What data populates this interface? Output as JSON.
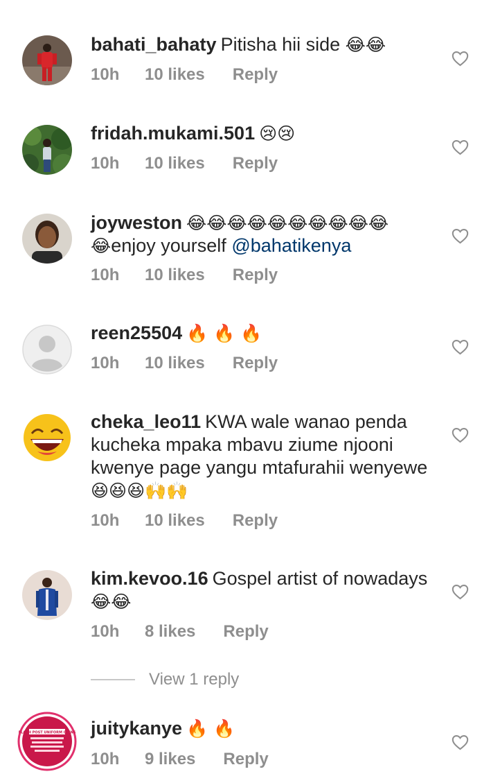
{
  "colors": {
    "meta": "#8e8e8e",
    "text": "#262626",
    "mention": "#00376b"
  },
  "comments": [
    {
      "username": "bahati_bahaty",
      "text": "Pitisha hii side",
      "emoji": "😂😂",
      "time": "10h",
      "likes": "10 likes",
      "reply": "Reply",
      "avatar": "avatar-red-outfit"
    },
    {
      "username": "fridah.mukami.501",
      "text": "",
      "emoji": "😢😢",
      "time": "10h",
      "likes": "10 likes",
      "reply": "Reply",
      "avatar": "avatar-greenery"
    },
    {
      "username": "joyweston",
      "emoji_lead": "😂😂😂😂😂😂😂😂😂😂",
      "emoji_line2": "😂",
      "text": "enjoy yourself ",
      "mention": "@bahatikenya",
      "time": "10h",
      "likes": "10 likes",
      "reply": "Reply",
      "avatar": "avatar-woman-portrait"
    },
    {
      "username": "reen25504",
      "text": "",
      "emoji": "🔥 🔥 🔥",
      "time": "10h",
      "likes": "10 likes",
      "reply": "Reply",
      "avatar": "avatar-default"
    },
    {
      "username": "cheka_leo11",
      "text": "KWA wale wanao penda kucheka mpaka mbavu ziume njooni kwenye page yangu mtafurahii wenyewe",
      "emoji": "😆😆😆🙌🙌",
      "time": "10h",
      "likes": "10 likes",
      "reply": "Reply",
      "avatar": "avatar-laughing-emoji"
    },
    {
      "username": "kim.kevoo.16",
      "text": "Gospel artist of nowadays",
      "emoji": "😂😂",
      "time": "10h",
      "likes": "8 likes",
      "reply": "Reply",
      "avatar": "avatar-man-blue-suit"
    },
    {
      "username": "juitykanye",
      "text": "",
      "emoji": "🔥 🔥",
      "time": "10h",
      "likes": "9 likes",
      "reply": "Reply",
      "avatar": "avatar-flash-poster"
    }
  ],
  "view_replies": "View 1 reply",
  "avatar_poster": {
    "line1": "FLASH POST UNIFORM GAINS"
  }
}
